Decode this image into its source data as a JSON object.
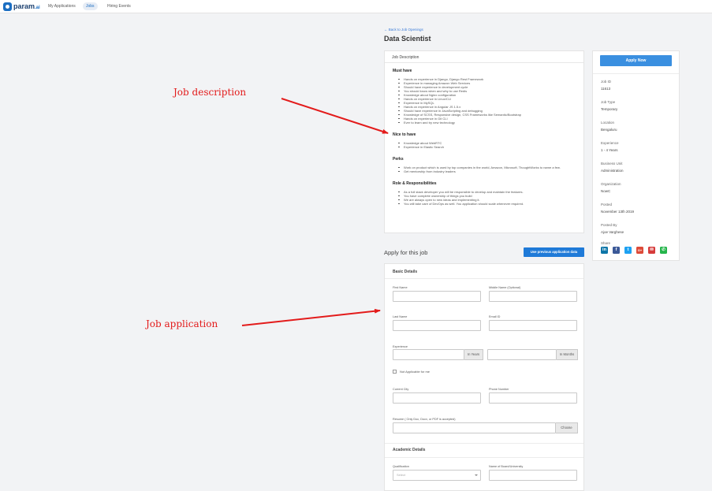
{
  "nav": {
    "logo_text": "param",
    "logo_suffix": ".ai",
    "items": [
      {
        "label": "My Applications"
      },
      {
        "label": "Jobs"
      },
      {
        "label": "Hiring Events"
      }
    ]
  },
  "header": {
    "back_link": "← Back to Job Openings",
    "title": "Data Scientist"
  },
  "job_description": {
    "card_title": "Job Description",
    "must_have": {
      "title": "Must have",
      "items": [
        "Hands on experience in Django, Django Rest Framework",
        "Experience in managing Amazon Web Services",
        "Should have experience in development cycle",
        "You should know when and why to use Redis",
        "Knowledge about Nginx configuration",
        "Hands on experience in Linux/CLI",
        "Experience in MySQL",
        "Hands on experience in Angular JS 1.5.x",
        "Should have experience in JavaScripting and debugging",
        "Knowledge of SCSS, Responsive design, CSS Frameworks like Semantic/Bootstrap",
        "Hands on experience in Git CLI",
        "Ever to learn and try new technology"
      ]
    },
    "nice_to_have": {
      "title": "Nice to have",
      "items": [
        "Knowledge about WebRTC",
        "Experience in Elastic Search"
      ]
    },
    "perks": {
      "title": "Perks",
      "items": [
        "Work on product which is used by top companies in the world, Amazon, Microsoft, ThoughtWorks to name a few.",
        "Get mentorship from industry leaders"
      ]
    },
    "roles": {
      "title": "Role & Responsibilities",
      "items": [
        "As a full stack developer you will be responsible to develop and maintain the features.",
        "You have complete ownership of things you build",
        "We are always open to new ideas and implementing it.",
        "You will take care of DevOps as well. You application should scale whenever required."
      ]
    }
  },
  "sidebar": {
    "apply_label": "Apply Now",
    "fields": [
      {
        "label": "Job ID",
        "value": "11613"
      },
      {
        "label": "Job Type",
        "value": "Temporary"
      },
      {
        "label": "Location",
        "value": "Bengaluru"
      },
      {
        "label": "Experience",
        "value": "1 - 4 Years"
      },
      {
        "label": "Business Unit",
        "value": "Administration"
      },
      {
        "label": "Organization",
        "value": "NowC"
      },
      {
        "label": "Posted",
        "value": "November 13th 2019"
      },
      {
        "label": "Posted By",
        "value": "Ajoe Varghese"
      }
    ],
    "share_label": "Share",
    "share_icons": [
      {
        "name": "linkedin-icon",
        "glyph": "in",
        "color": "#0e76a8"
      },
      {
        "name": "facebook-icon",
        "glyph": "f",
        "color": "#3b5998"
      },
      {
        "name": "twitter-icon",
        "glyph": "t",
        "color": "#1da1f2"
      },
      {
        "name": "google-plus-icon",
        "glyph": "G+",
        "color": "#dd4b39"
      },
      {
        "name": "email-icon",
        "glyph": "✉",
        "color": "#d63b3b"
      },
      {
        "name": "whatsapp-icon",
        "glyph": "✆",
        "color": "#25b54b"
      }
    ]
  },
  "apply": {
    "title": "Apply for this job",
    "prev_button": "Use previous application data",
    "basic_details": {
      "title": "Basic Details",
      "first_name": "First Name",
      "middle_name": "Middle Name (Optional)",
      "last_name": "Last Name",
      "email": "Email ID",
      "experience": "Experience",
      "in_years": "In Years",
      "in_months": "In Months",
      "not_applicable": "Not Applicable for me",
      "current_city": "Current City",
      "phone": "Phone Number",
      "resume": "Resume ( Only Doc, Docx, or PDF is accepted)",
      "choose": "Choose"
    },
    "academic_details": {
      "title": "Academic Details",
      "qualification": "Qualification",
      "qualification_placeholder": "Select",
      "board": "Name of Board/University"
    }
  },
  "annotations": {
    "job_description": "Job description",
    "job_application": "Job application",
    "arrow_color": "#e31b1b"
  }
}
